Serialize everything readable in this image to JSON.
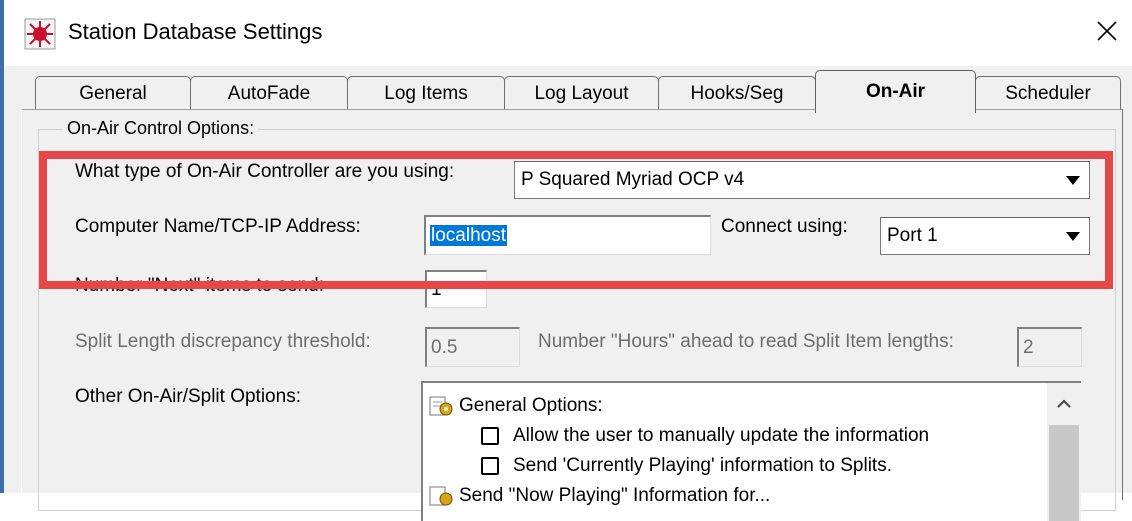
{
  "window": {
    "title": "Station Database Settings",
    "close_symbol": "✕"
  },
  "tabs": [
    {
      "label": "General",
      "active": false
    },
    {
      "label": "AutoFade",
      "active": false
    },
    {
      "label": "Log Items",
      "active": false
    },
    {
      "label": "Log Layout",
      "active": false
    },
    {
      "label": "Hooks/Seg",
      "active": false
    },
    {
      "label": "On-Air",
      "active": true
    },
    {
      "label": "Scheduler",
      "active": false
    }
  ],
  "group": {
    "legend": "On-Air Control Options:"
  },
  "controller": {
    "label": "What type of On-Air Controller are you using:",
    "value": "P Squared Myriad OCP v4"
  },
  "address": {
    "label": "Computer Name/TCP-IP Address:",
    "value": "localhost"
  },
  "connect": {
    "label": "Connect using:",
    "value": "Port 1"
  },
  "next_items": {
    "label": "Number \"Next\" items to send:",
    "value": "1"
  },
  "split_threshold": {
    "label": "Split Length discrepancy threshold:",
    "value": "0.5"
  },
  "hours_ahead": {
    "label": "Number \"Hours\" ahead to read Split Item lengths:",
    "value": "2"
  },
  "other_options": {
    "label": "Other On-Air/Split Options:",
    "group_title": "General Options:",
    "items": [
      {
        "label": "Allow the user to manually update the information",
        "checked": false
      },
      {
        "label": "Send 'Currently Playing' information to Splits.",
        "checked": false
      }
    ],
    "partial_next": "Send \"Now Playing\" Information for..."
  },
  "annotation": {
    "color": "#e8474a"
  }
}
